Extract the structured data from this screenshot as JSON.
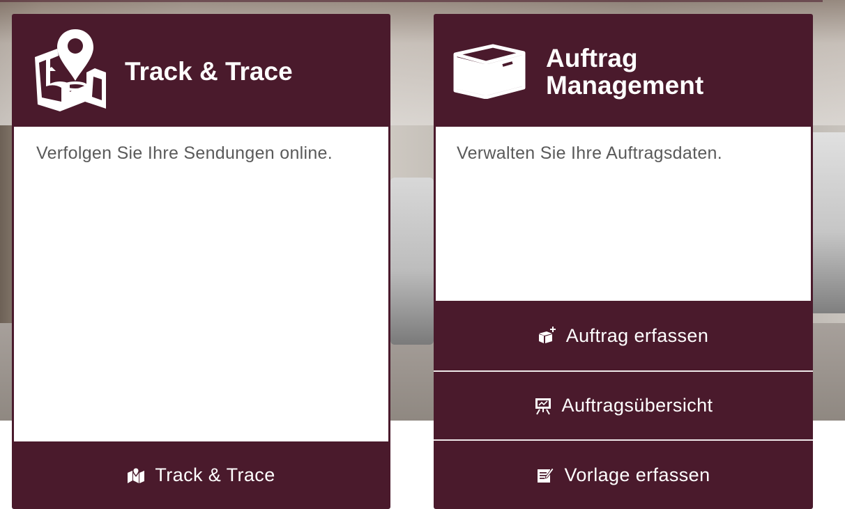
{
  "track_card": {
    "title": "Track & Trace",
    "description": "Verfolgen Sie Ihre Sendungen online.",
    "icon": "map-pin-icon",
    "button": {
      "label": "Track & Trace",
      "icon": "map-pin-icon"
    }
  },
  "order_card": {
    "title_line1": "Auftrag",
    "title_line2": "Management",
    "description": "Verwalten Sie Ihre Auftragsdaten.",
    "icon": "box-icon",
    "buttons": [
      {
        "label": "Auftrag erfassen",
        "icon": "box-plus-icon"
      },
      {
        "label": "Auftragsübersicht",
        "icon": "presentation-board-icon"
      },
      {
        "label": "Vorlage erfassen",
        "icon": "template-edit-icon"
      }
    ]
  },
  "colors": {
    "brand": "#4a1a2c",
    "panel": "#ffffff",
    "text": "#5a5a5a"
  }
}
